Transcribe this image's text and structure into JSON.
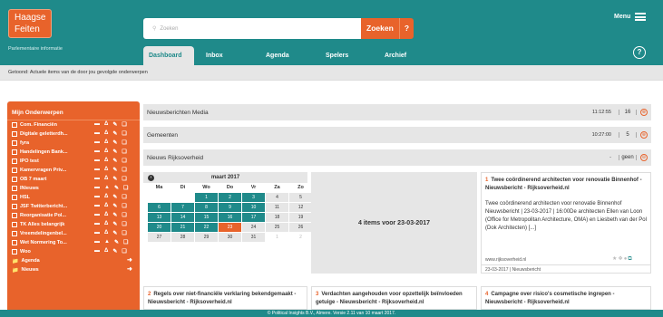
{
  "header": {
    "logo_line1": "Haagse",
    "logo_line2": "Feiten",
    "subtitle": "Parlementaire informatie",
    "search_placeholder": "Zoeken",
    "search_button": "Zoeken",
    "search_help": "?",
    "menu_label": "Menu",
    "help_icon": "?",
    "tabs": [
      "Dashboard",
      "Inbox",
      "Agenda",
      "Spelers",
      "Archief"
    ]
  },
  "notice": "Getoond: Actuele items van de door jou gevolgde onderwerpen",
  "sidebar": {
    "title": "Mijn Onderwerpen",
    "topics": [
      "Com. Financiën",
      "Digitale geletterdh...",
      "fyra",
      "Handelingen Bank...",
      "IPO test",
      "Kamervragen Priv...",
      "OB 7 maart",
      "INieuws",
      "HSL",
      "JSF Twitterbericht...",
      "Reorganisatie Pol...",
      "TK Alles belangrijk",
      "Vreemdelingenbel...",
      "Wet Normering To...",
      "Woo"
    ],
    "links": [
      "Agenda",
      "Nieuws"
    ]
  },
  "panels": [
    {
      "title": "Nieuwsberichten Media",
      "time": "11:12:55",
      "count": "16"
    },
    {
      "title": "Gemeenten",
      "time": "10:27:00",
      "count": "5"
    },
    {
      "title": "Nieuws Rijksoverheid",
      "time": "-",
      "count": "geen"
    }
  ],
  "calendar": {
    "month": "maart 2017",
    "weekdays": [
      "Ma",
      "Di",
      "Wo",
      "Do",
      "Vr",
      "Za",
      "Zo"
    ],
    "weeks": [
      [
        "",
        "",
        "1",
        "2",
        "3",
        "4",
        "5"
      ],
      [
        "6",
        "7",
        "8",
        "9",
        "10",
        "11",
        "12"
      ],
      [
        "13",
        "14",
        "15",
        "16",
        "17",
        "18",
        "19"
      ],
      [
        "20",
        "21",
        "22",
        "23",
        "24",
        "25",
        "26"
      ],
      [
        "27",
        "28",
        "29",
        "30",
        "31",
        "1",
        "2"
      ]
    ],
    "selected_summary": "4 items voor 23-03-2017"
  },
  "cards": [
    {
      "num": "1",
      "title": "Twee coördinerend architecten voor renovatie Binnenhof - Nieuwsbericht - Rijksoverheid.nl",
      "body": "Twee coördinerend architecten voor renovatie Binnenhof Nieuwsbericht | 23-03-2017 | 16:00De architecten Ellen van Loon (Office for Metropolitan Architecture, OMA) en Liesbeth van der Pol (Dok Architecten) [...]",
      "source": "www.rijksoverheid.nl",
      "footer": "23-03-2017 | Nieuwsbericht"
    },
    {
      "num": "2",
      "title": "Regels over niet-financiële verklaring bekendgemaakt - Nieuwsbericht - Rijksoverheid.nl"
    },
    {
      "num": "3",
      "title": "Verdachten aangehouden voor opzettelijk beïnvloeden getuige - Nieuwsbericht - Rijksoverheid.nl"
    },
    {
      "num": "4",
      "title": "Campagne over risico's cosmetische ingrepen - Nieuwsbericht - Rijksoverheid.nl"
    }
  ],
  "footer": "© Political Insights B.V., Almere. Versie 2.11 van 10 maart 2017."
}
